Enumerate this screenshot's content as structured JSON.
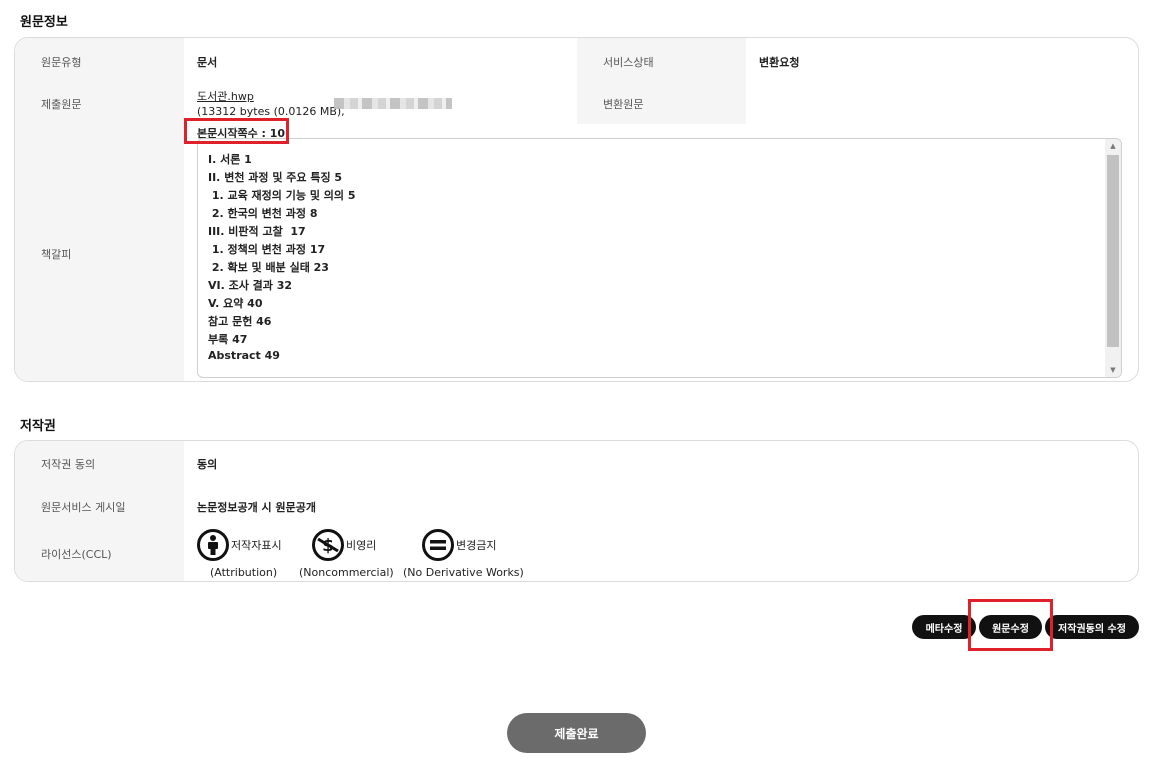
{
  "original_info": {
    "title": "원문정보",
    "type_label": "원문유형",
    "type_value": "문서",
    "service_status_label": "서비스상태",
    "service_status_value": "변환요청",
    "submitted_label": "제출원문",
    "file_name": "도서관.hwp",
    "file_size": "(13312 bytes (0.0126 MB),",
    "converted_label": "변환원문",
    "start_page": "본문시작쪽수 : 10",
    "bookmark_label": "책갈피",
    "toc": [
      "I. 서론 1",
      "II. 변천 과정 및 주요 특징 5",
      " 1. 교육 재정의 기능 및 의의 5",
      " 2. 한국의 변천 과정 8",
      "III. 비판적 고찰  17",
      " 1. 정책의 변천 과정 17",
      " 2. 확보 및 배분 실태 23",
      "VI. 조사 결과 32",
      "V. 요약 40",
      "참고 문헌 46",
      "부록 47",
      "Abstract 49"
    ]
  },
  "copyright": {
    "title": "저작권",
    "consent_label": "저작권 동의",
    "consent_value": "동의",
    "post_date_label": "원문서비스 게시일",
    "post_date_value": "논문정보공개 시 원문공개",
    "license_label": "라이선스(CCL)",
    "licenses": [
      {
        "icon": "attribution-icon",
        "label": "저작자표시",
        "sub": "(Attribution)"
      },
      {
        "icon": "noncommercial-icon",
        "label": "비영리",
        "sub": "(Noncommercial)"
      },
      {
        "icon": "no-derivatives-icon",
        "label": "변경금지",
        "sub": "(No Derivative Works)"
      }
    ]
  },
  "actions": {
    "edit_meta": "메타수정",
    "edit_original": "원문수정",
    "edit_copyright": "저작권동의 수정",
    "submit": "제출완료"
  },
  "colors": {
    "highlight": "#e0202a",
    "button_dark": "#111111",
    "submit_button": "#6b6b6b"
  }
}
